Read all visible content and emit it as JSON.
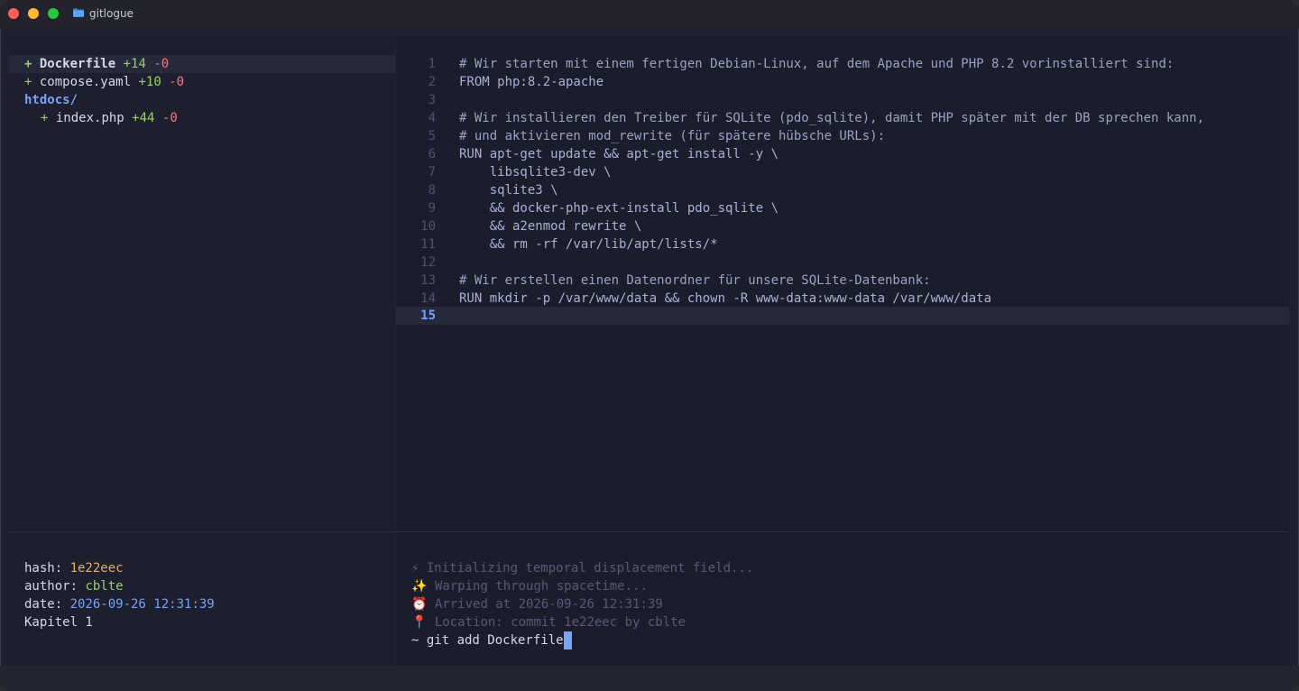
{
  "window": {
    "title": "gitlogue"
  },
  "file_tree": [
    {
      "prefix": "+",
      "name": "Dockerfile",
      "added": "+14",
      "removed": "-0",
      "selected": true
    },
    {
      "prefix": "+",
      "name": "compose.yaml",
      "added": "+10",
      "removed": "-0"
    },
    {
      "dir": "htdocs/"
    },
    {
      "prefix": "+",
      "name": "index.php",
      "added": "+44",
      "removed": "-0"
    }
  ],
  "editor": {
    "current_line": "15",
    "lines": [
      {
        "n": "1",
        "text": "# Wir starten mit einem fertigen Debian-Linux, auf dem Apache und PHP 8.2 vorinstalliert sind:"
      },
      {
        "n": "2",
        "text": "FROM php:8.2-apache"
      },
      {
        "n": "3",
        "text": ""
      },
      {
        "n": "4",
        "text": "# Wir installieren den Treiber für SQLite (pdo_sqlite), damit PHP später mit der DB sprechen kann,"
      },
      {
        "n": "5",
        "text": "# und aktivieren mod_rewrite (für spätere hübsche URLs):"
      },
      {
        "n": "6",
        "text": "RUN apt-get update && apt-get install -y \\"
      },
      {
        "n": "7",
        "text": "    libsqlite3-dev \\"
      },
      {
        "n": "8",
        "text": "    sqlite3 \\"
      },
      {
        "n": "9",
        "text": "    && docker-php-ext-install pdo_sqlite \\"
      },
      {
        "n": "10",
        "text": "    && a2enmod rewrite \\"
      },
      {
        "n": "11",
        "text": "    && rm -rf /var/lib/apt/lists/*"
      },
      {
        "n": "12",
        "text": ""
      },
      {
        "n": "13",
        "text": "# Wir erstellen einen Datenordner für unsere SQLite-Datenbank:"
      },
      {
        "n": "14",
        "text": "RUN mkdir -p /var/www/data && chown -R www-data:www-data /var/www/data"
      },
      {
        "n": "15",
        "text": ""
      }
    ]
  },
  "commit": {
    "hash_label": "hash: ",
    "hash": "1e22eec",
    "author_label": "author: ",
    "author": "cblte",
    "date_label": "date: ",
    "date": "2026-09-26 12:31:39",
    "message": "Kapitel 1"
  },
  "terminal": {
    "log": [
      {
        "icon": "⚡",
        "text": "Initializing temporal displacement field..."
      },
      {
        "icon": "✨",
        "text": "Warping through spacetime..."
      },
      {
        "icon": "⏰",
        "text": "Arrived at 2026-09-26 12:31:39"
      },
      {
        "icon": "📍",
        "text": "Location: commit 1e22eec by cblte"
      }
    ],
    "prompt": "~ git add Dockerfile"
  },
  "colors": {
    "added": "#9ece6a",
    "removed": "#f7768e",
    "accent": "#7aa2f7",
    "hash": "#e0af68"
  }
}
